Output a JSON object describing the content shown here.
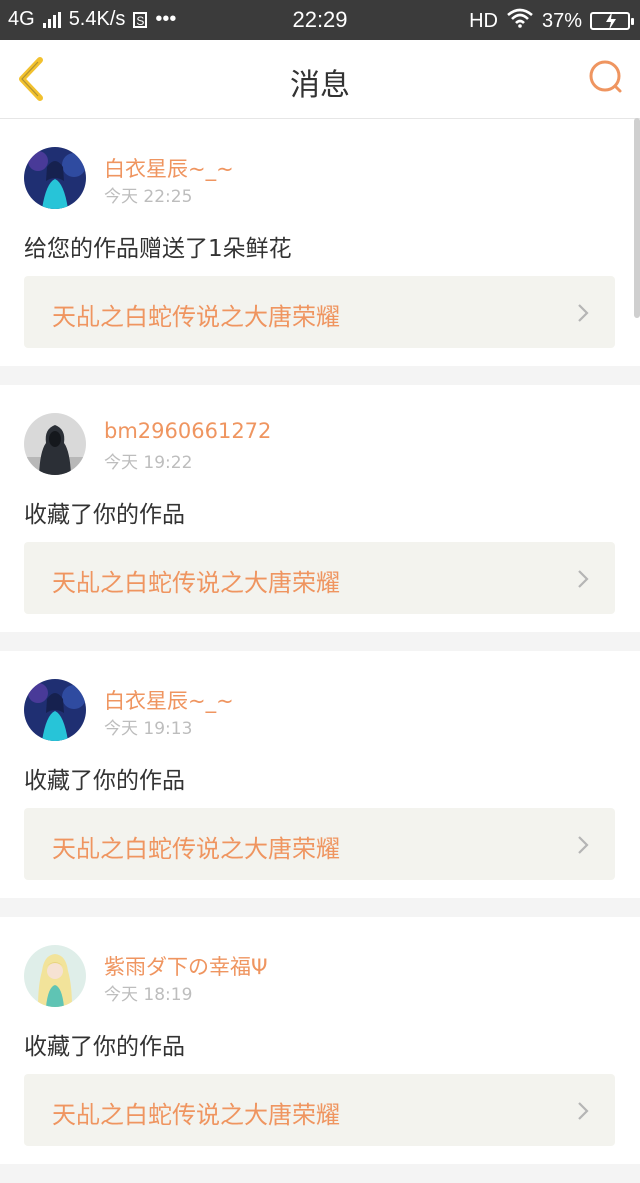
{
  "status_bar": {
    "network": "4G",
    "speed": "5.4K/s",
    "app_indicator": "S",
    "more": "•••",
    "time": "22:29",
    "hd": "HD",
    "battery": "37%"
  },
  "header": {
    "title": "消息"
  },
  "messages": [
    {
      "username": "白衣星辰~_~",
      "time": "今天 22:25",
      "action": "给您的作品赠送了1朵鲜花",
      "work_title": "天乩之白蛇传说之大唐荣耀",
      "avatar_icon": "anime-girl-blue-avatar"
    },
    {
      "username": "bm2960661272",
      "time": "今天 19:22",
      "action": "收藏了你的作品",
      "work_title": "天乩之白蛇传说之大唐荣耀",
      "avatar_icon": "hooded-figure-avatar"
    },
    {
      "username": "白衣星辰~_~",
      "time": "今天 19:13",
      "action": "收藏了你的作品",
      "work_title": "天乩之白蛇传说之大唐荣耀",
      "avatar_icon": "anime-girl-blue-avatar"
    },
    {
      "username": "紫雨ダ下の幸福Ψ",
      "time": "今天 18:19",
      "action": "收藏了你的作品",
      "work_title": "天乩之白蛇传说之大唐荣耀",
      "avatar_icon": "blonde-girl-avatar"
    }
  ],
  "colors": {
    "accent": "#ef9560",
    "back_icon": "#f2c12e",
    "status_bar_bg": "#3b3b3b",
    "link_bg": "#f3f3ee"
  }
}
